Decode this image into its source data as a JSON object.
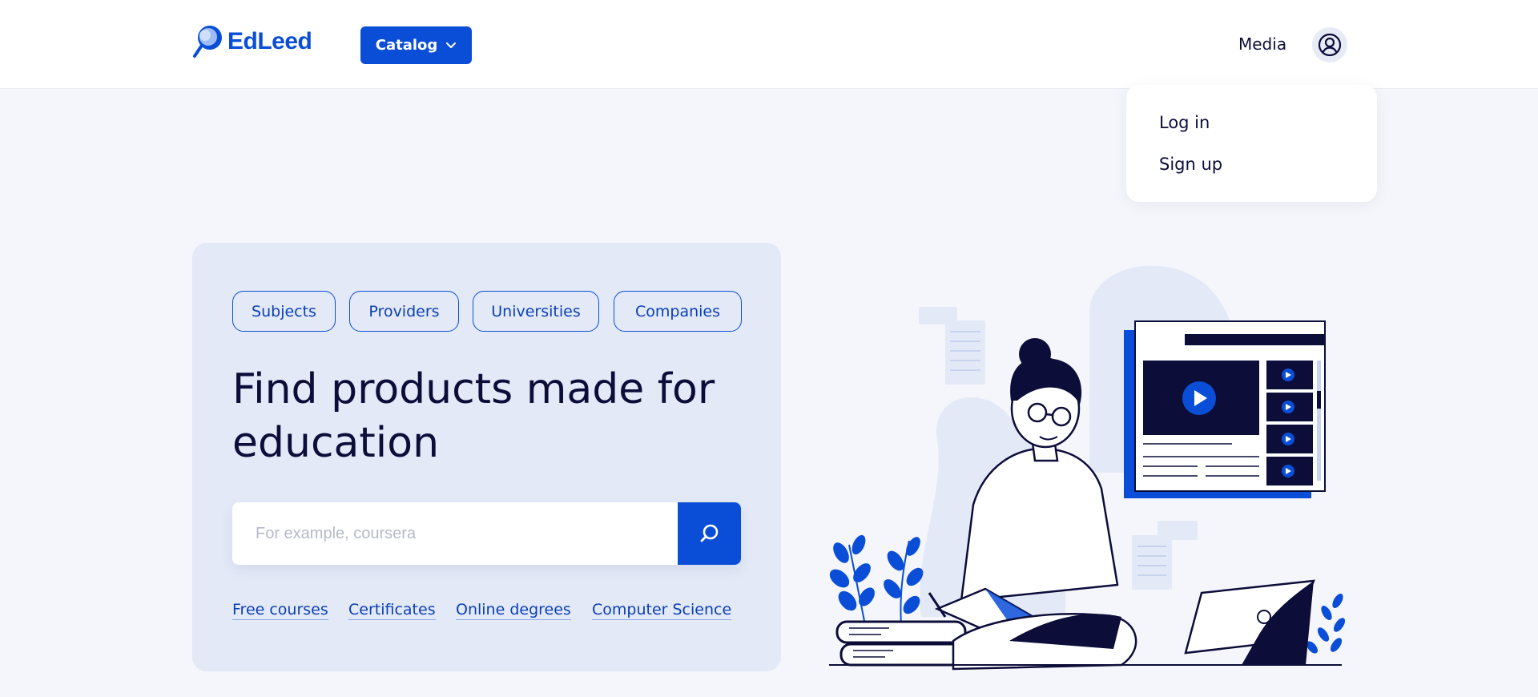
{
  "header": {
    "logo_text": "EdLeed",
    "catalog_label": "Catalog",
    "media_label": "Media"
  },
  "user_menu": {
    "items": [
      {
        "label": "Log in"
      },
      {
        "label": "Sign up"
      }
    ]
  },
  "hero": {
    "chips": [
      {
        "label": "Subjects"
      },
      {
        "label": "Providers"
      },
      {
        "label": "Universities"
      },
      {
        "label": "Companies"
      }
    ],
    "title": "Find products made for education",
    "search": {
      "placeholder": "For example, coursera",
      "value": ""
    },
    "quick_links": [
      {
        "label": "Free courses"
      },
      {
        "label": "Certificates"
      },
      {
        "label": "Online degrees"
      },
      {
        "label": "Computer Science"
      }
    ]
  },
  "colors": {
    "brand": "#0a4ed8",
    "page_background": "#f5f6fb",
    "card_background": "#e3e9f7",
    "ink": "#0d0d3a"
  },
  "icons": {
    "logo": "magnifier-logo-icon",
    "catalog_caret": "chevron-down-icon",
    "user": "user-circle-icon",
    "search": "search-icon",
    "illustration": "student-studying-illustration"
  }
}
